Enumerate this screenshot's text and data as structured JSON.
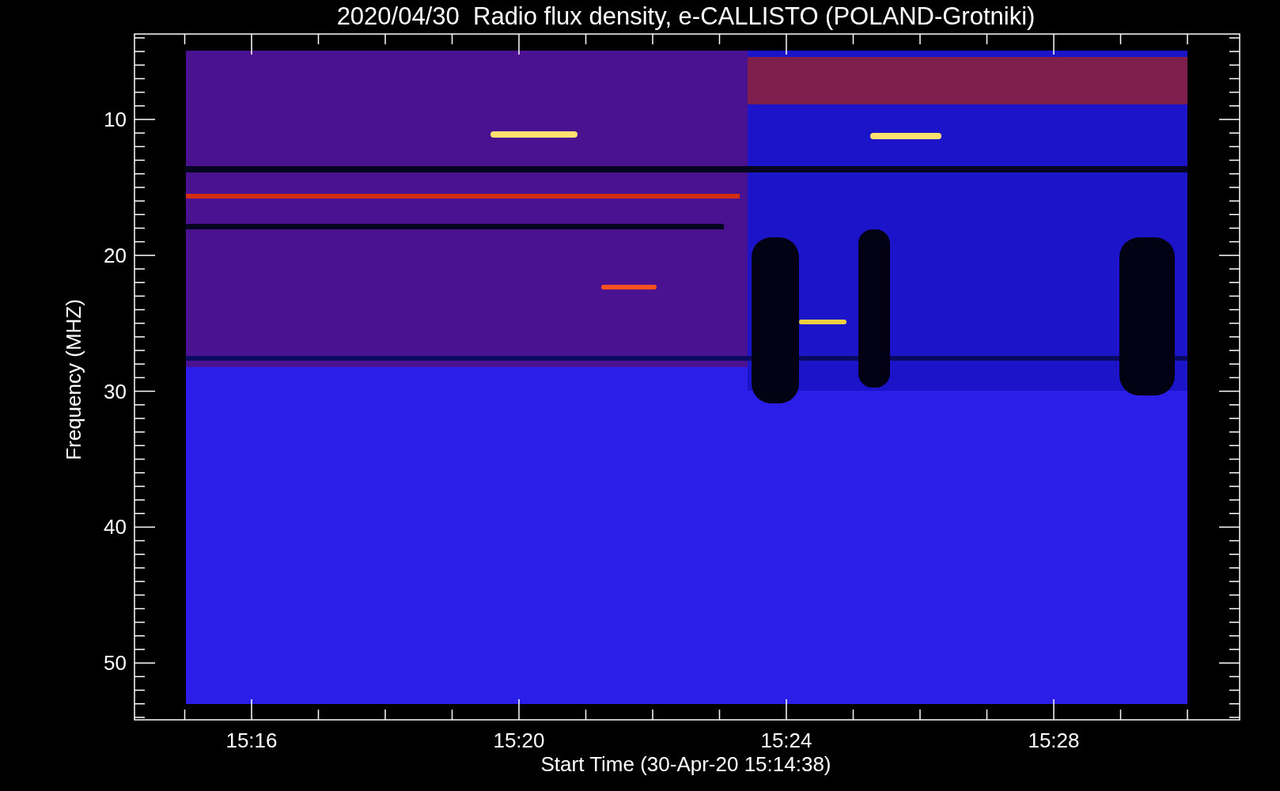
{
  "plot": {
    "title": "2020/04/30  Radio flux density, e-CALLISTO (POLAND-Grotniki)",
    "xlabel": "Start Time (30-Apr-20 15:14:38)",
    "ylabel": "Frequency (MHZ)",
    "x_tick_labels": [
      "15:16",
      "15:20",
      "15:24",
      "15:28"
    ],
    "y_tick_labels": [
      "10",
      "20",
      "30",
      "40",
      "50"
    ]
  }
}
